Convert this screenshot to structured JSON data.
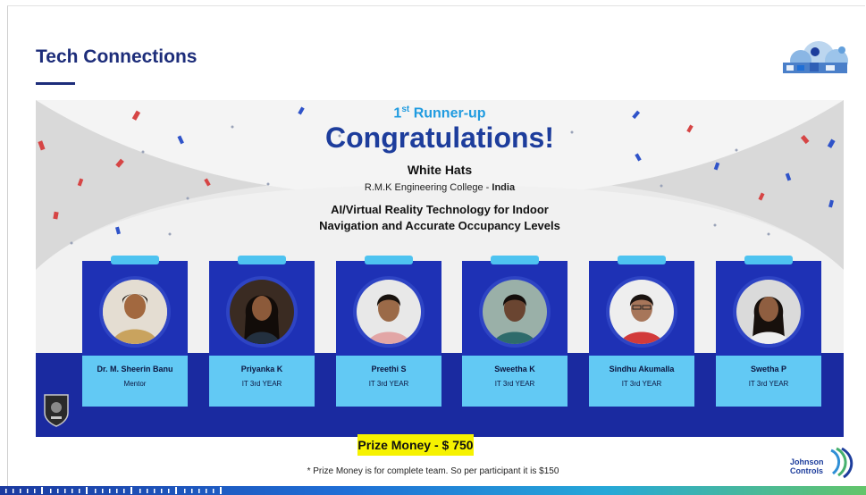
{
  "header": {
    "title": "Tech Connections"
  },
  "banner": {
    "runner_up_num": "1",
    "runner_up_sup": "st",
    "runner_up_text": "Runner-up",
    "headline": "Congratulations!",
    "team_name": "White Hats",
    "college_name": "R.M.K Engineering College - ",
    "college_country": "India",
    "project_line1": "AI/Virtual Reality Technology for Indoor",
    "project_line2": "Navigation and Accurate Occupancy Levels"
  },
  "members": [
    {
      "name": "Dr. M. Sheerin Banu",
      "role": "Mentor"
    },
    {
      "name": "Priyanka K",
      "role": "IT 3rd YEAR"
    },
    {
      "name": "Preethi S",
      "role": "IT 3rd YEAR"
    },
    {
      "name": "Sweetha K",
      "role": "IT 3rd YEAR"
    },
    {
      "name": "Sindhu Akumalla",
      "role": "IT 3rd YEAR"
    },
    {
      "name": "Swetha P",
      "role": "IT 3rd YEAR"
    }
  ],
  "prize": {
    "label": "Prize Money - $ 750",
    "footnote": "* Prize Money is for complete team. So per participant it is $150"
  },
  "brand": {
    "line1": "Johnson",
    "line2": "Controls"
  },
  "colors": {
    "title_navy": "#1d2d7a",
    "headline_blue": "#1d3d9c",
    "runner_up_blue": "#1f9be0",
    "card_blue": "#1e31b5",
    "card_info_cyan": "#62c9f4",
    "prize_yellow": "#f6f200"
  }
}
